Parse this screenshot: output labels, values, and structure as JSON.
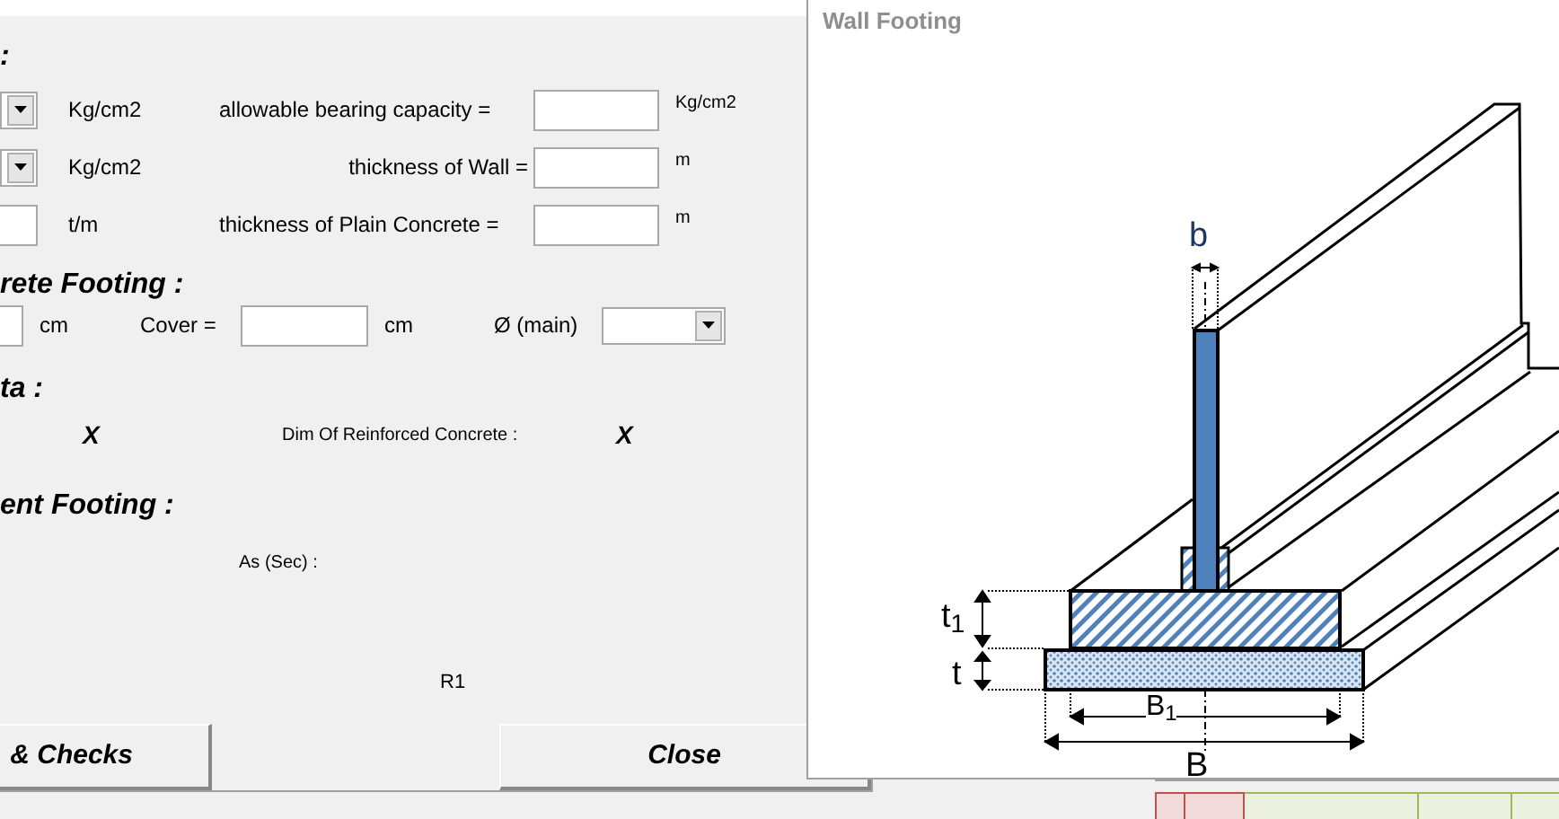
{
  "inputs_heading": ":",
  "input_rows": [
    {
      "kind": "dropdown",
      "unit": "Kg/cm2",
      "label": "allowable bearing capacity =",
      "right_unit": "Kg/cm2"
    },
    {
      "kind": "dropdown",
      "unit": "Kg/cm2",
      "label": "thickness of Wall =",
      "right_unit": "m"
    },
    {
      "kind": "field",
      "unit": "t/m",
      "label": "thickness of Plain Concrete =",
      "right_unit": "m"
    }
  ],
  "footing_heading": "rete Footing :",
  "footing_row": {
    "unit": "cm",
    "cover_label": "Cover =",
    "cover_unit": "cm",
    "bar_label": "Ø (main)"
  },
  "data_heading": "ta :",
  "dims": {
    "value_1": "X",
    "label": "Dim Of Reinforced Concrete :",
    "value_2": "X"
  },
  "reinforcement_heading": "ent Footing :",
  "as_sec_label": "As (Sec) :",
  "r1_label": "R1",
  "buttons": [
    {
      "label": "& Checks"
    },
    {
      "label": "Close"
    }
  ],
  "picture_window": {
    "title": "Wall Footing",
    "labels": {
      "b": "b",
      "t1": "t$_{1}$",
      "t": "t",
      "b1": "B$_{1}$",
      "B": "B"
    }
  }
}
